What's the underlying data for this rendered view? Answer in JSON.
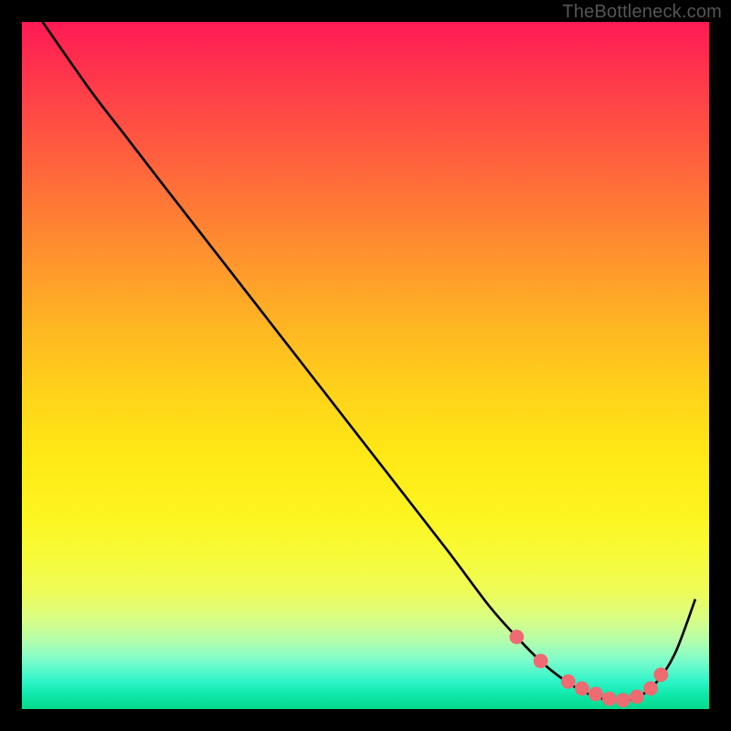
{
  "attribution": "TheBottleneck.com",
  "chart_data": {
    "type": "line",
    "title": "",
    "xlabel": "",
    "ylabel": "",
    "xlim": [
      0,
      100
    ],
    "ylim": [
      0,
      100
    ],
    "series": [
      {
        "name": "curve",
        "x": [
          3,
          10,
          15,
          20,
          27,
          34,
          41,
          48,
          55,
          62,
          68,
          72,
          76,
          80,
          83,
          86,
          89,
          92,
          95,
          98
        ],
        "y": [
          100,
          90,
          83.5,
          77,
          68,
          59,
          50,
          41,
          32,
          23,
          15,
          10.5,
          6.5,
          3.5,
          2,
          1.3,
          1.5,
          3.5,
          8,
          16
        ]
      }
    ],
    "markers": {
      "name": "highlight-points",
      "x": [
        72,
        75.5,
        79.5,
        81.5,
        83.5,
        85.5,
        87.5,
        89.5,
        91.5,
        93
      ],
      "y": [
        10.5,
        7,
        4,
        3,
        2.2,
        1.5,
        1.3,
        1.8,
        3,
        5
      ]
    },
    "colors": {
      "line": "#000000",
      "marker_fill": "#ed6b71",
      "marker_stroke": "#ed6b71",
      "background_top": "#ff1a55",
      "background_bottom": "#05d98c",
      "frame": "#000000"
    }
  }
}
